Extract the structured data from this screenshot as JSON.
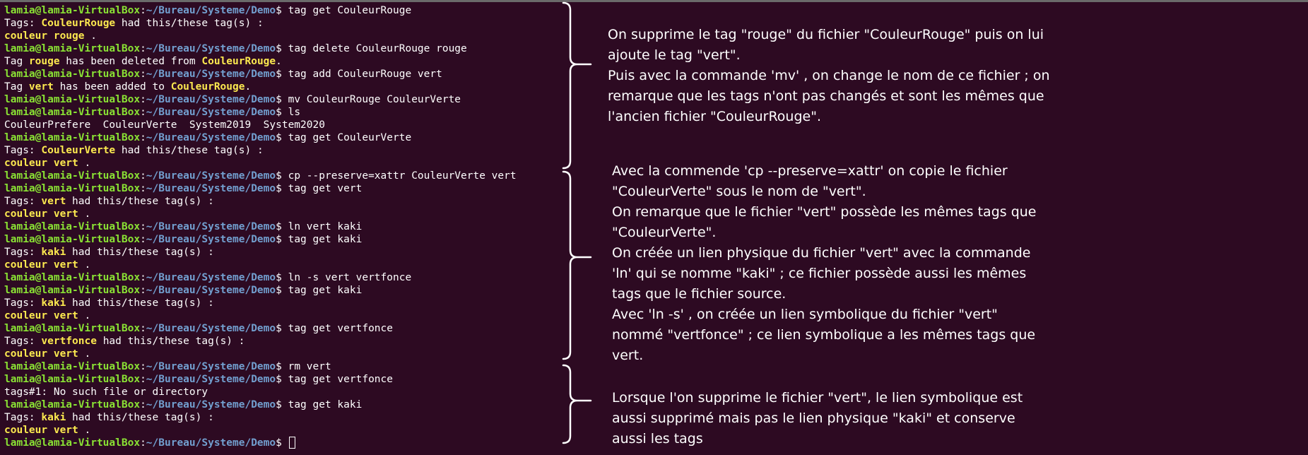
{
  "prompt": {
    "user": "lamia@lamia-VirtualBox",
    "sep": ":",
    "path": "~/Bureau/Systeme/Demo",
    "dollar": "$"
  },
  "terminal": {
    "lines": [
      {
        "type": "cmd",
        "text": "tag get CouleurRouge"
      },
      {
        "type": "out",
        "parts": [
          {
            "t": "Tags: "
          },
          {
            "t": "CouleurRouge",
            "hl": true
          },
          {
            "t": " had this/these tag(s) :"
          }
        ]
      },
      {
        "type": "out",
        "parts": [
          {
            "t": "couleur rouge",
            "hl": true
          },
          {
            "t": " ."
          }
        ]
      },
      {
        "type": "cmd",
        "text": "tag delete CouleurRouge rouge"
      },
      {
        "type": "out",
        "parts": [
          {
            "t": "Tag "
          },
          {
            "t": "rouge",
            "hl": true
          },
          {
            "t": " has been deleted from "
          },
          {
            "t": "CouleurRouge",
            "hl": true
          },
          {
            "t": "."
          }
        ]
      },
      {
        "type": "cmd",
        "text": "tag add CouleurRouge vert"
      },
      {
        "type": "out",
        "parts": [
          {
            "t": "Tag "
          },
          {
            "t": "vert",
            "hl": true
          },
          {
            "t": " has been added to "
          },
          {
            "t": "CouleurRouge",
            "hl": true
          },
          {
            "t": "."
          }
        ]
      },
      {
        "type": "cmd",
        "text": "mv CouleurRouge CouleurVerte"
      },
      {
        "type": "cmd",
        "text": "ls"
      },
      {
        "type": "out",
        "parts": [
          {
            "t": "CouleurPrefere  CouleurVerte  System2019  System2020"
          }
        ]
      },
      {
        "type": "cmd",
        "text": "tag get CouleurVerte"
      },
      {
        "type": "out",
        "parts": [
          {
            "t": "Tags: "
          },
          {
            "t": "CouleurVerte",
            "hl": true
          },
          {
            "t": " had this/these tag(s) :"
          }
        ]
      },
      {
        "type": "out",
        "parts": [
          {
            "t": "couleur vert",
            "hl": true
          },
          {
            "t": " ."
          }
        ]
      },
      {
        "type": "cmd",
        "text": "cp --preserve=xattr CouleurVerte vert"
      },
      {
        "type": "cmd",
        "text": "tag get vert"
      },
      {
        "type": "out",
        "parts": [
          {
            "t": "Tags: "
          },
          {
            "t": "vert",
            "hl": true
          },
          {
            "t": " had this/these tag(s) :"
          }
        ]
      },
      {
        "type": "out",
        "parts": [
          {
            "t": "couleur vert",
            "hl": true
          },
          {
            "t": " ."
          }
        ]
      },
      {
        "type": "cmd",
        "text": "ln vert kaki"
      },
      {
        "type": "cmd",
        "text": "tag get kaki"
      },
      {
        "type": "out",
        "parts": [
          {
            "t": "Tags: "
          },
          {
            "t": "kaki",
            "hl": true
          },
          {
            "t": " had this/these tag(s) :"
          }
        ]
      },
      {
        "type": "out",
        "parts": [
          {
            "t": "couleur vert",
            "hl": true
          },
          {
            "t": " ."
          }
        ]
      },
      {
        "type": "cmd",
        "text": "ln -s vert vertfonce"
      },
      {
        "type": "cmd",
        "text": "tag get kaki"
      },
      {
        "type": "out",
        "parts": [
          {
            "t": "Tags: "
          },
          {
            "t": "kaki",
            "hl": true
          },
          {
            "t": " had this/these tag(s) :"
          }
        ]
      },
      {
        "type": "out",
        "parts": [
          {
            "t": "couleur vert",
            "hl": true
          },
          {
            "t": " ."
          }
        ]
      },
      {
        "type": "cmd",
        "text": "tag get vertfonce"
      },
      {
        "type": "out",
        "parts": [
          {
            "t": "Tags: "
          },
          {
            "t": "vertfonce",
            "hl": true
          },
          {
            "t": " had this/these tag(s) :"
          }
        ]
      },
      {
        "type": "out",
        "parts": [
          {
            "t": "couleur vert",
            "hl": true
          },
          {
            "t": " ."
          }
        ]
      },
      {
        "type": "cmd",
        "text": "rm vert"
      },
      {
        "type": "cmd",
        "text": "tag get vertfonce"
      },
      {
        "type": "out",
        "parts": [
          {
            "t": "tags#1: No such file or directory"
          }
        ]
      },
      {
        "type": "cmd",
        "text": "tag get kaki"
      },
      {
        "type": "out",
        "parts": [
          {
            "t": "Tags: "
          },
          {
            "t": "kaki",
            "hl": true
          },
          {
            "t": " had this/these tag(s) :"
          }
        ]
      },
      {
        "type": "out",
        "parts": [
          {
            "t": "couleur vert",
            "hl": true
          },
          {
            "t": " ."
          }
        ]
      },
      {
        "type": "cmd",
        "text": "",
        "cursor": true
      }
    ]
  },
  "annotations": [
    {
      "lines": [
        "On supprime le tag \"rouge\" du fichier \"CouleurRouge\" puis on lui",
        "ajoute le tag \"vert\".",
        "Puis avec la commande 'mv' , on change le nom de ce fichier ; on",
        "remarque que les tags n'ont pas changés et sont les mêmes que",
        "l'ancien fichier \"CouleurRouge\"."
      ]
    },
    {
      "lines": [
        "Avec la commende 'cp --preserve=xattr' on copie le fichier",
        "\"CouleurVerte\" sous le nom de \"vert\".",
        "On remarque que le fichier \"vert\" possède les mêmes tags que",
        "\"CouleurVerte\".",
        "On créée un lien physique du fichier \"vert\" avec la commande",
        "'ln' qui se nomme \"kaki\" ; ce fichier possède aussi les mêmes",
        "tags que le fichier source.",
        "Avec 'ln -s' , on créée un lien symbolique du fichier \"vert\"",
        "nommé \"vertfonce\" ; ce lien symbolique a les mêmes tags que",
        "vert."
      ]
    },
    {
      "lines": [
        "Lorsque l'on supprime le fichier \"vert\", le lien symbolique est",
        "aussi supprimé mais pas le lien physique \"kaki\" et conserve",
        "aussi les tags"
      ]
    }
  ],
  "colors": {
    "background": "#2d0a22",
    "prompt_user": "#8ae234",
    "prompt_path": "#729fcf",
    "highlight": "#fce94f",
    "text": "#ffffff"
  }
}
